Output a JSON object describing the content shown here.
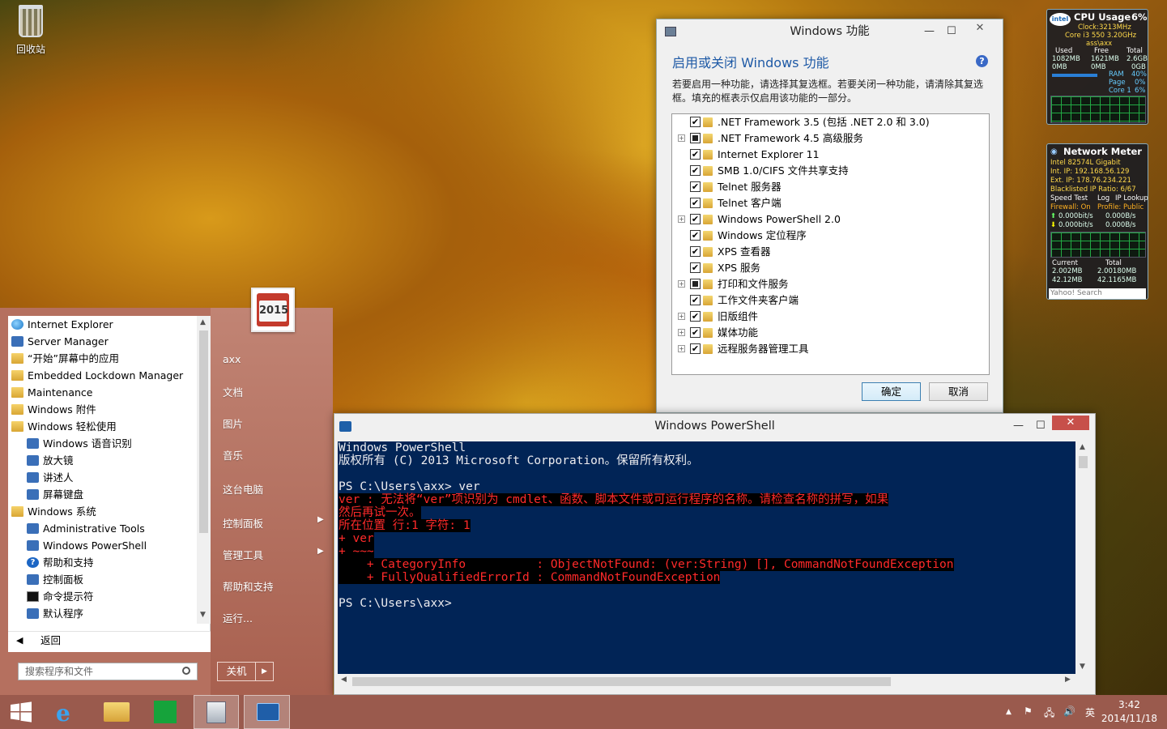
{
  "desktop": {
    "recycle_bin_label": "回收站"
  },
  "start_menu": {
    "calendar_year": "2015",
    "apps": [
      {
        "label": "Internet Explorer",
        "icon": "ie-icon",
        "sub": false
      },
      {
        "label": "Server Manager",
        "icon": "server-manager-icon",
        "sub": false
      },
      {
        "label": "“开始”屏幕中的应用",
        "icon": "folder-icon",
        "sub": false
      },
      {
        "label": "Embedded Lockdown Manager",
        "icon": "folder-icon",
        "sub": false
      },
      {
        "label": "Maintenance",
        "icon": "folder-icon",
        "sub": false
      },
      {
        "label": "Windows 附件",
        "icon": "folder-icon",
        "sub": false
      },
      {
        "label": "Windows 轻松使用",
        "icon": "folder-icon",
        "sub": false
      },
      {
        "label": "Windows 语音识别",
        "icon": "microphone-icon",
        "sub": true
      },
      {
        "label": "放大镜",
        "icon": "magnifier-icon",
        "sub": true
      },
      {
        "label": "讲述人",
        "icon": "narrator-icon",
        "sub": true
      },
      {
        "label": "屏幕键盘",
        "icon": "keyboard-icon",
        "sub": true
      },
      {
        "label": "Windows 系统",
        "icon": "folder-icon",
        "sub": false
      },
      {
        "label": "Administrative Tools",
        "icon": "admin-tools-icon",
        "sub": true
      },
      {
        "label": "Windows PowerShell",
        "icon": "powershell-icon",
        "sub": true
      },
      {
        "label": "帮助和支持",
        "icon": "help-icon",
        "sub": true
      },
      {
        "label": "控制面板",
        "icon": "control-panel-icon",
        "sub": true
      },
      {
        "label": "命令提示符",
        "icon": "cmd-icon",
        "sub": true
      },
      {
        "label": "默认程序",
        "icon": "default-programs-icon",
        "sub": true
      }
    ],
    "back_label": "返回",
    "search_placeholder": "搜索程序和文件",
    "right_items": [
      {
        "label": "axx",
        "arrow": false
      },
      {
        "label": "文档",
        "arrow": false
      },
      {
        "label": "图片",
        "arrow": false
      },
      {
        "label": "音乐",
        "arrow": false
      },
      {
        "label": "这台电脑",
        "arrow": false
      },
      {
        "label": "控制面板",
        "arrow": true
      },
      {
        "label": "管理工具",
        "arrow": true
      },
      {
        "label": "帮助和支持",
        "arrow": false
      },
      {
        "label": "运行...",
        "arrow": false
      }
    ],
    "shutdown_label": "关机"
  },
  "features_dialog": {
    "title": "Windows 功能",
    "heading": "启用或关闭 Windows 功能",
    "description": "若要启用一种功能，请选择其复选框。若要关闭一种功能，请清除其复选框。填充的框表示仅启用该功能的一部分。",
    "items": [
      {
        "label": ".NET Framework 3.5 (包括 .NET 2.0 和 3.0)",
        "state": "checked",
        "expandable": false
      },
      {
        "label": ".NET Framework 4.5 高级服务",
        "state": "partial",
        "expandable": true
      },
      {
        "label": "Internet Explorer 11",
        "state": "checked",
        "expandable": false
      },
      {
        "label": "SMB 1.0/CIFS 文件共享支持",
        "state": "checked",
        "expandable": false
      },
      {
        "label": "Telnet 服务器",
        "state": "checked",
        "expandable": false
      },
      {
        "label": "Telnet 客户端",
        "state": "checked",
        "expandable": false
      },
      {
        "label": "Windows PowerShell 2.0",
        "state": "checked",
        "expandable": true
      },
      {
        "label": "Windows 定位程序",
        "state": "checked",
        "expandable": false
      },
      {
        "label": "XPS 查看器",
        "state": "checked",
        "expandable": false
      },
      {
        "label": "XPS 服务",
        "state": "checked",
        "expandable": false
      },
      {
        "label": "打印和文件服务",
        "state": "partial",
        "expandable": true
      },
      {
        "label": "工作文件夹客户端",
        "state": "checked",
        "expandable": false
      },
      {
        "label": "旧版组件",
        "state": "checked",
        "expandable": true
      },
      {
        "label": "媒体功能",
        "state": "checked",
        "expandable": true
      },
      {
        "label": "远程服务器管理工具",
        "state": "checked",
        "expandable": true
      }
    ],
    "ok_label": "确定",
    "cancel_label": "取消"
  },
  "powershell": {
    "title": "Windows PowerShell",
    "lines": [
      {
        "text": "Windows PowerShell",
        "err": false
      },
      {
        "text": "版权所有 (C) 2013 Microsoft Corporation。保留所有权利。",
        "err": false
      },
      {
        "text": "",
        "err": false
      },
      {
        "text": "PS C:\\Users\\axx> ver",
        "err": false
      },
      {
        "text": "ver : 无法将“ver”项识别为 cmdlet、函数、脚本文件或可运行程序的名称。请检查名称的拼写，如果",
        "err": true
      },
      {
        "text": "然后再试一次。",
        "err": true
      },
      {
        "text": "所在位置 行:1 字符: 1",
        "err": true
      },
      {
        "text": "+ ver",
        "err": true
      },
      {
        "text": "+ ~~~",
        "err": true
      },
      {
        "text": "    + CategoryInfo          : ObjectNotFound: (ver:String) [], CommandNotFoundException",
        "err": true
      },
      {
        "text": "    + FullyQualifiedErrorId : CommandNotFoundException",
        "err": true
      },
      {
        "text": "",
        "err": false
      },
      {
        "text": "PS C:\\Users\\axx>",
        "err": false
      }
    ]
  },
  "cpu_gadget": {
    "title": "CPU Usage",
    "percent": "6%",
    "clock": "Clock:3213MHz",
    "cpu": "Core i3 550 3.20GHz",
    "host": "ass\\axx",
    "col_used": "Used",
    "col_free": "Free",
    "col_total": "Total",
    "row1": [
      "1082MB",
      "1621MB",
      "2.6GB"
    ],
    "row2": [
      "0MB",
      "0MB",
      "0GB"
    ],
    "ram_label": "RAM",
    "ram_value": "40%",
    "page_label": "Page",
    "page_value": "0%",
    "core_label": "Core 1",
    "core_value": "6%"
  },
  "net_gadget": {
    "title": "Network Meter",
    "adapter": "Intel 82574L Gigabit",
    "int_ip": "Int. IP: 192.168.56.129",
    "ext_ip": "Ext. IP: 178.76.234.221",
    "blacklisted": "Blacklisted IP Ratio: 6/67",
    "speed_test": "Speed Test",
    "log": "Log",
    "ip_lookup": "IP Lookup",
    "firewall": "Firewall: On",
    "profile": "Profile: Public",
    "up1": "0.000bit/s",
    "up2": "0.000B/s",
    "down1": "0.000bit/s",
    "down2": "0.000B/s",
    "current_label": "Current",
    "total_label": "Total",
    "cur_up": "2.002MB",
    "cur_down": "42.12MB",
    "tot_up": "2.00180MB",
    "tot_down": "42.1165MB",
    "search_placeholder": "Yahoo! Search"
  },
  "taskbar": {
    "time": "3:42",
    "date": "2014/11/18",
    "ime": "英"
  }
}
